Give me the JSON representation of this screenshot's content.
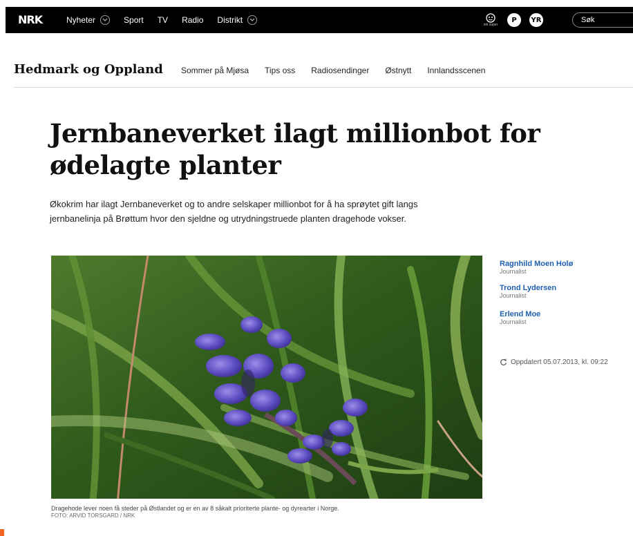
{
  "topnav": {
    "logo": "NRK",
    "items": [
      {
        "label": "Nyheter",
        "has_dropdown": true
      },
      {
        "label": "Sport",
        "has_dropdown": false
      },
      {
        "label": "TV",
        "has_dropdown": false
      },
      {
        "label": "Radio",
        "has_dropdown": false
      },
      {
        "label": "Distrikt",
        "has_dropdown": true
      }
    ],
    "icons": [
      {
        "name": "nrk-super-icon",
        "label": "nrk super"
      },
      {
        "name": "p3-icon",
        "label": "P"
      },
      {
        "name": "yr-icon",
        "label": "YR"
      }
    ],
    "search_placeholder": "Søk"
  },
  "district": {
    "title": "Hedmark og Oppland",
    "links": [
      "Sommer på Mjøsa",
      "Tips oss",
      "Radiosendinger",
      "Østnytt",
      "Innlandsscenen"
    ]
  },
  "article": {
    "headline": "Jernbaneverket ilagt millionbot for ødelagte planter",
    "lede": "Økokrim har ilagt Jernbaneverket og to andre selskaper millionbot for å ha sprøytet gift langs jernbanelinja på Brøttum hvor den sjeldne og utrydningstruede planten dragehode vokser.",
    "image": {
      "caption": "Dragehode lever noen få steder på Østlandet og er en av 8 såkalt prioriterte plante- og dyrearter i Norge.",
      "credit": "FOTO: ARVID TORSGARD / NRK"
    },
    "authors": [
      {
        "name": "Ragnhild Moen Holø",
        "role": "Journalist"
      },
      {
        "name": "Trond Lydersen",
        "role": "Journalist"
      },
      {
        "name": "Erlend Moe",
        "role": "Journalist"
      }
    ],
    "updated": "Oppdatert 05.07.2013, kl. 09:22"
  },
  "colors": {
    "topbar": "#000000",
    "author_link": "#1e5fb0",
    "accent": "#f26522"
  }
}
